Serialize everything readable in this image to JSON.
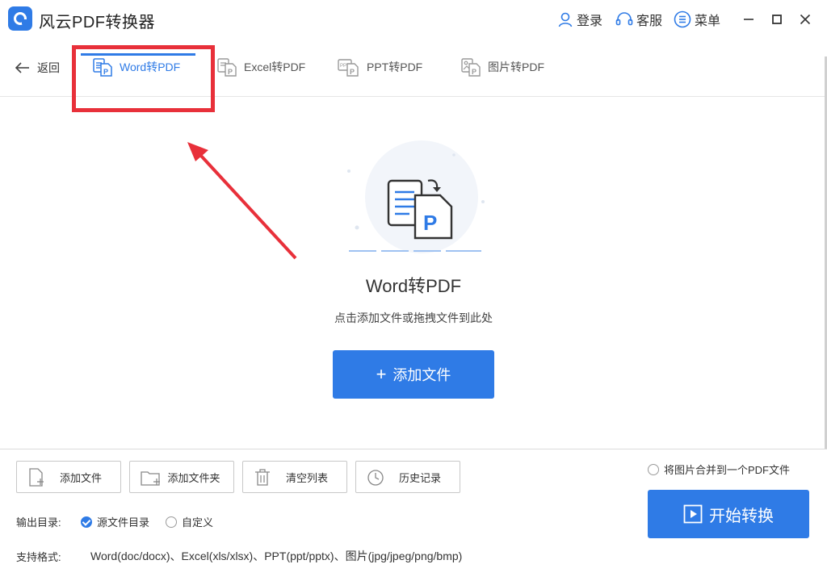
{
  "app": {
    "title": "风云PDF转换器"
  },
  "titlebar": {
    "login": "登录",
    "support": "客服",
    "menu": "菜单"
  },
  "nav": {
    "back": "返回",
    "tabs": [
      {
        "label": "Word转PDF",
        "icon": "word-doc-icon",
        "active": true
      },
      {
        "label": "Excel转PDF",
        "icon": "excel-doc-icon",
        "active": false
      },
      {
        "label": "PPT转PDF",
        "icon": "ppt-doc-icon",
        "active": false
      },
      {
        "label": "图片转PDF",
        "icon": "image-doc-icon",
        "active": false
      }
    ]
  },
  "dropzone": {
    "title": "Word转PDF",
    "hint": "点击添加文件或拖拽文件到此处",
    "add_button": "添加文件"
  },
  "toolbar": {
    "add_file": "添加文件",
    "add_folder": "添加文件夹",
    "clear_list": "清空列表",
    "history": "历史记录"
  },
  "options": {
    "merge_images": "将图片合并到一个PDF文件",
    "output_dir_label": "输出目录:",
    "source_dir": "源文件目录",
    "custom": "自定义",
    "selected": "源文件目录"
  },
  "start_button": "开始转换",
  "formats": {
    "label": "支持格式:",
    "value": "Word(doc/docx)、Excel(xls/xlsx)、PPT(ppt/pptx)、图片(jpg/jpeg/png/bmp)"
  },
  "colors": {
    "accent": "#2f7be6",
    "highlight": "#e8303a"
  }
}
